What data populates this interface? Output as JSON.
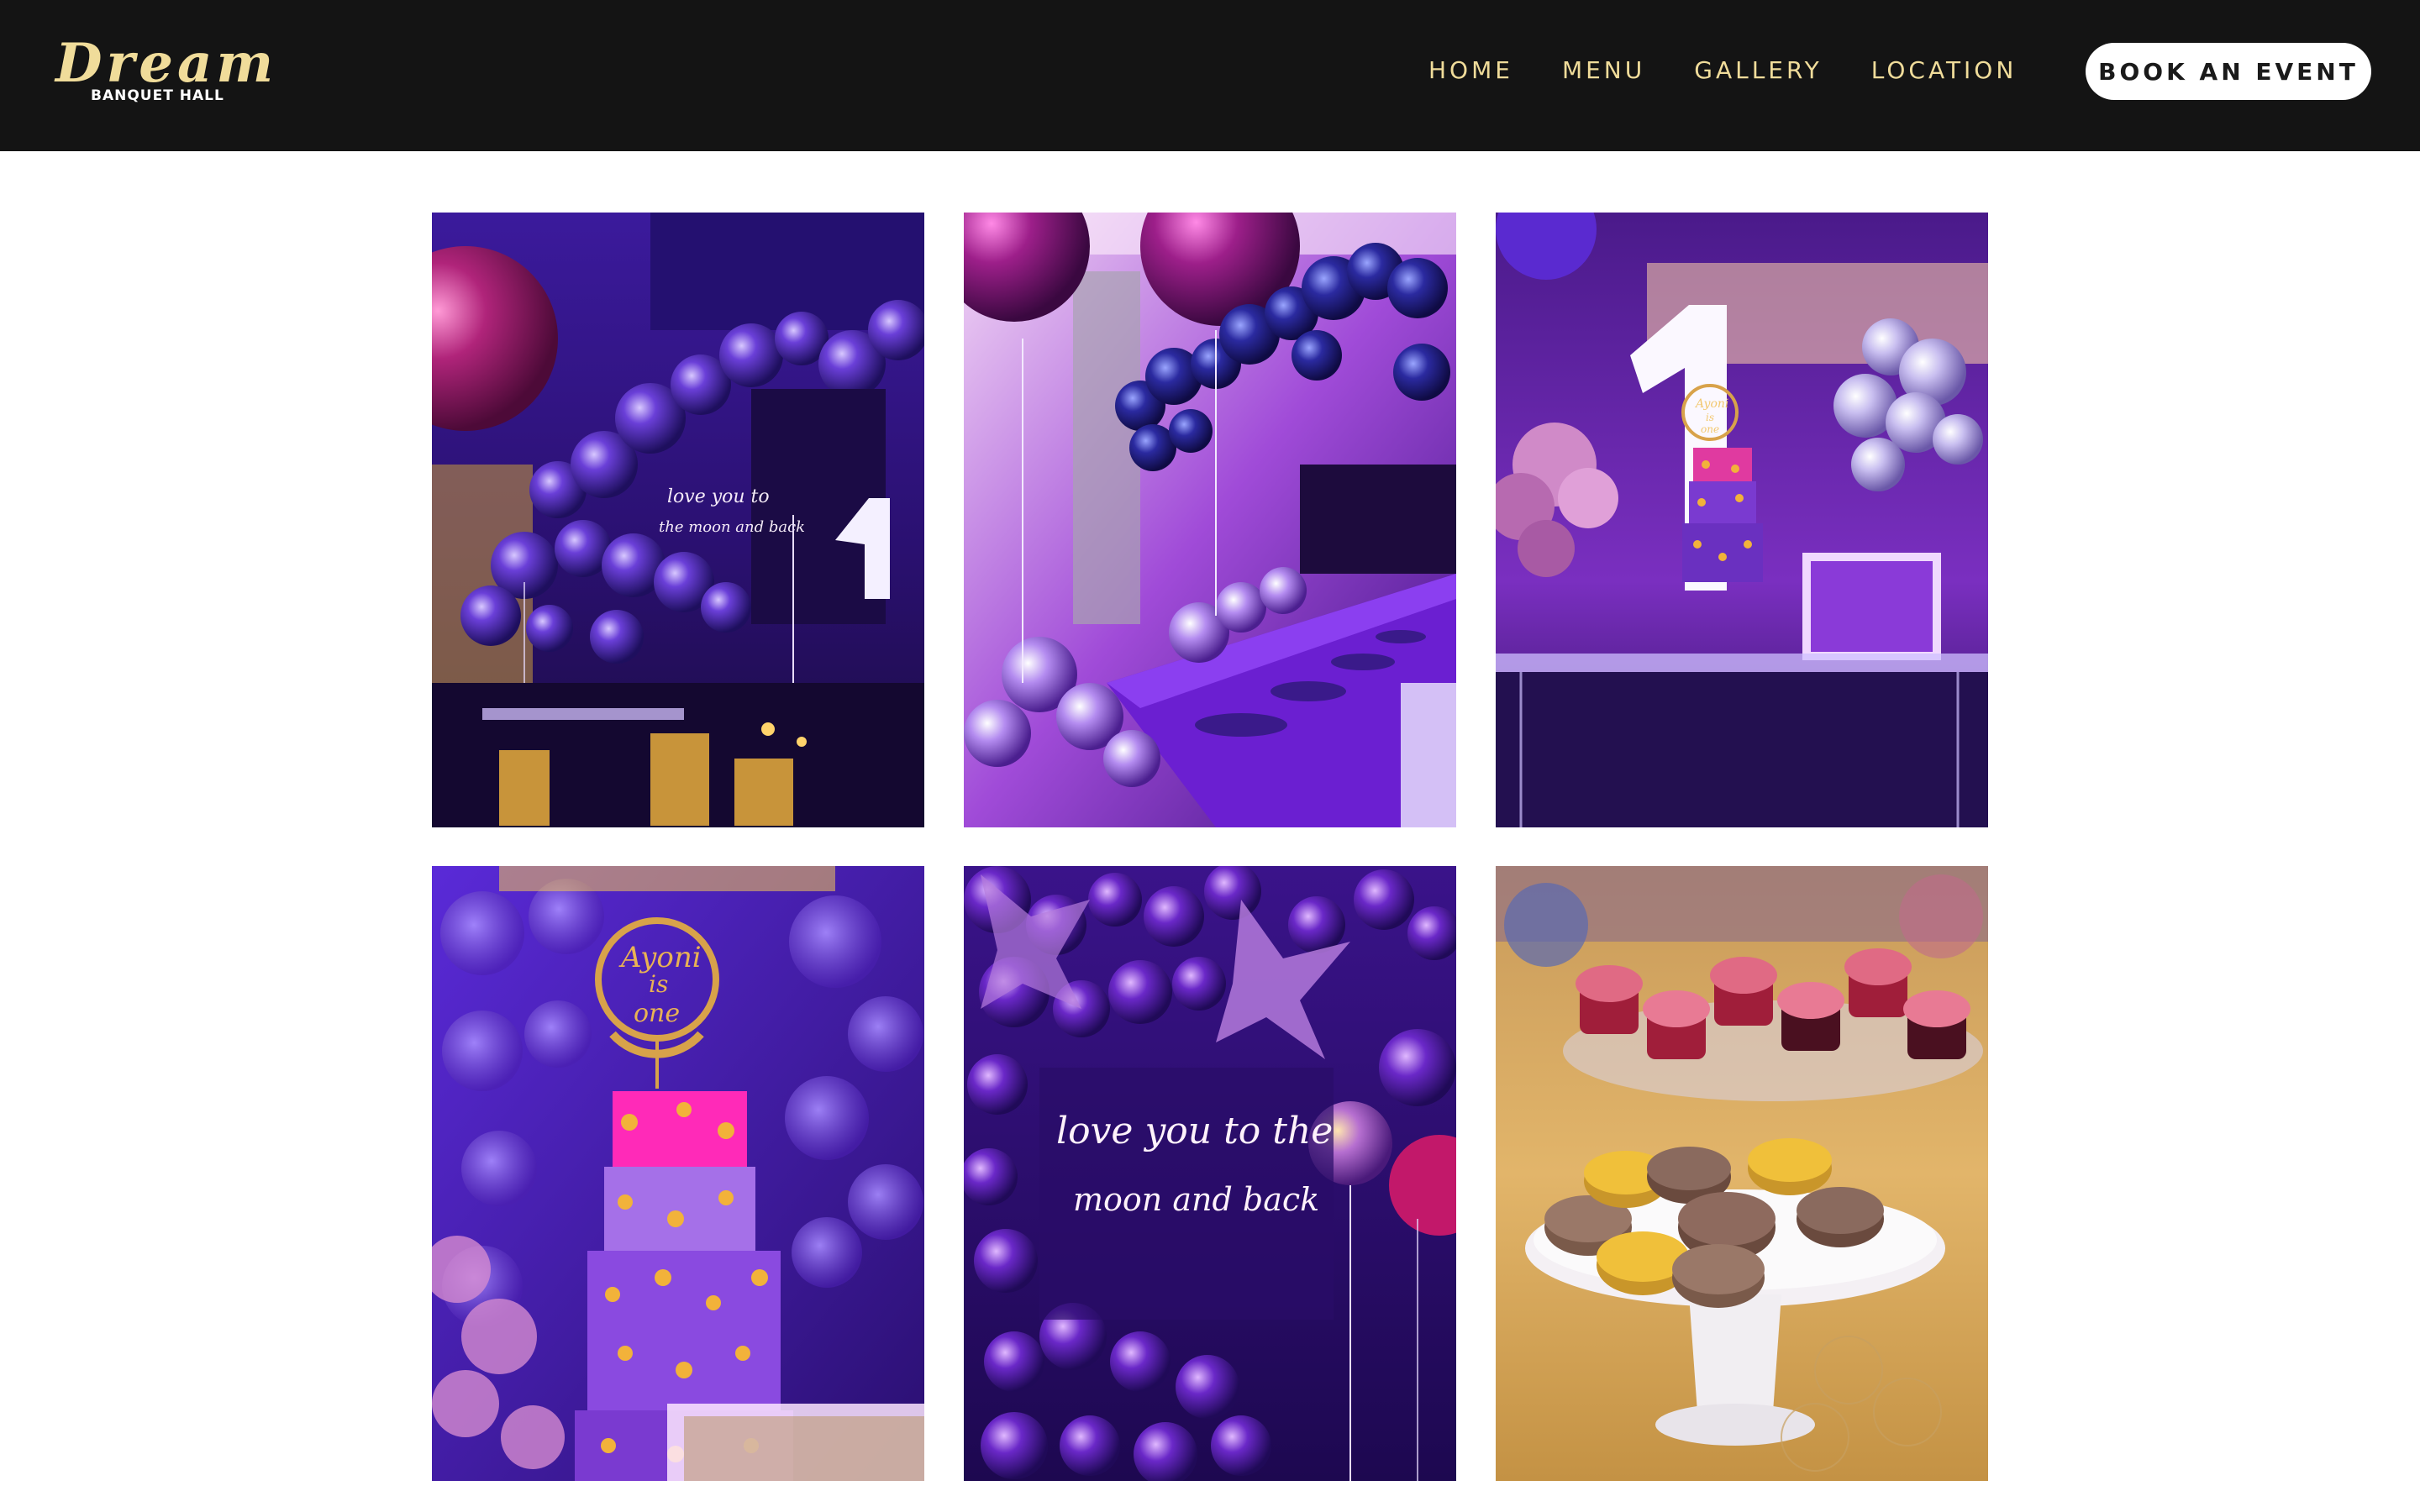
{
  "header": {
    "logo": {
      "script": "Dream",
      "subtitle": "BANQUET HALL"
    },
    "nav": [
      {
        "label": "HOME"
      },
      {
        "label": "MENU"
      },
      {
        "label": "GALLERY"
      },
      {
        "label": "LOCATION"
      }
    ],
    "cta_label": "BOOK AN EVENT"
  },
  "colors": {
    "header_bg": "#141414",
    "nav_text": "#f0dc9a",
    "cta_bg": "#ffffff",
    "cta_text": "#1a1a1a",
    "page_bg": "#ffffff"
  },
  "gallery": {
    "photos": [
      {
        "scene": "purple balloon wall party hall",
        "neon_text": [
          "love you to",
          "the moon and back"
        ]
      },
      {
        "scene": "long purple banquet table with chrome balloon centerpieces"
      },
      {
        "scene": "birthday cake table with large number 1 and silver balloons",
        "cake_topper": [
          "Ayoni",
          "is",
          "one"
        ]
      },
      {
        "scene": "close-up of star and moon decorated birthday cake",
        "cake_topper": [
          "Ayoni",
          "is",
          "one"
        ]
      },
      {
        "scene": "neon sign on purple balloon backdrop",
        "neon_text": [
          "love you to the",
          "moon and back"
        ]
      },
      {
        "scene": "dessert stand with macarons and red velvet cupcakes"
      }
    ]
  }
}
